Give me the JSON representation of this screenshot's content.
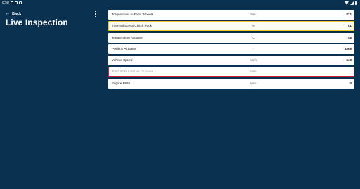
{
  "status_bar": {
    "time": "8:50"
  },
  "header": {
    "back_label": "Back",
    "back_icon": "arrow-left-icon",
    "title": "Live Inspection",
    "menu_icon": "more-vert-icon"
  },
  "parameters": [
    {
      "name": "Torque max. to Front Wheels",
      "unit": "Nm",
      "value": "821",
      "state": "normal"
    },
    {
      "name": "Thermal Stress Clutch Pack",
      "unit": "%",
      "value": "51",
      "state": "warning"
    },
    {
      "name": "Temperature Actuator",
      "unit": "°C",
      "value": "48",
      "state": "normal"
    },
    {
      "name": "Position Actuator",
      "unit": "-",
      "value": "4868",
      "state": "normal"
    },
    {
      "name": "Vehicle Speed",
      "unit": "km/h",
      "value": "240",
      "state": "normal"
    },
    {
      "name": "Total Work Load on Clutches",
      "unit": "kWh",
      "value": "-",
      "state": "alert"
    },
    {
      "name": "Engine RPM",
      "unit": "rpm",
      "value": "0",
      "state": "normal"
    }
  ],
  "colors": {
    "background": "#0b3150",
    "row_background": "#ffffff",
    "warning_border": "#f3c623",
    "alert_border": "#c01f3a"
  }
}
